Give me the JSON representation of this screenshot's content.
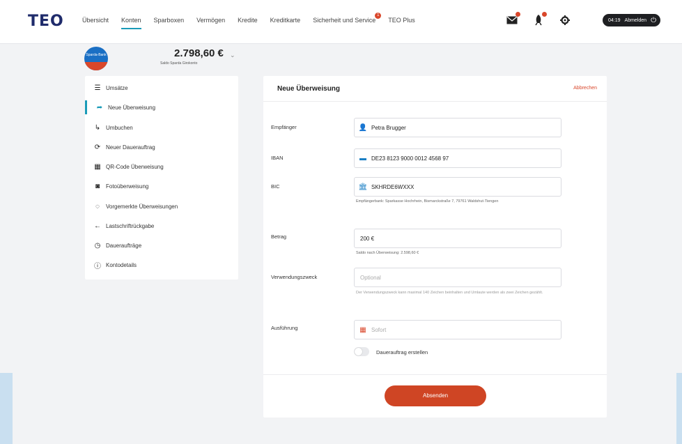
{
  "header": {
    "logo": "TEO",
    "nav": [
      "Übersicht",
      "Konten",
      "Sparboxen",
      "Vermögen",
      "Kredite",
      "Kreditkarte",
      "Sicherheit und Service",
      "TEO Plus"
    ],
    "active_nav": "Konten",
    "service_badge": "1",
    "icons": [
      "mail-icon",
      "rocket-icon",
      "gear-icon"
    ],
    "session_time": "04:19",
    "logout_label": "Abmelden"
  },
  "account": {
    "bank_logo_text": "Sparda-Bank",
    "balance": "2.798,60 €",
    "subtitle": "Saldo Sparda Girokonto"
  },
  "sidebar": {
    "items": [
      {
        "label": "Umsätze",
        "icon": "list-icon"
      },
      {
        "label": "Neue Überweisung",
        "icon": "transfer-icon",
        "active": true
      },
      {
        "label": "Umbuchen",
        "icon": "rebook-icon"
      },
      {
        "label": "Neuer Dauerauftrag",
        "icon": "repeat-icon"
      },
      {
        "label": "QR-Code Überweisung",
        "icon": "qr-icon"
      },
      {
        "label": "Fotoüberweisung",
        "icon": "camera-icon"
      },
      {
        "label": "Vorgemerkte Überweisungen",
        "icon": "pending-icon"
      },
      {
        "label": "Lastschriftrückgabe",
        "icon": "back-arrow-icon"
      },
      {
        "label": "Daueraufträge",
        "icon": "clock-icon"
      },
      {
        "label": "Kontodetails",
        "icon": "info-icon"
      }
    ]
  },
  "form": {
    "title": "Neue Überweisung",
    "cancel_label": "Abbrechen",
    "recipient_label": "Empfänger",
    "recipient_value": "Petra Brugger",
    "iban_label": "IBAN",
    "iban_value": "DE23 8123 9000 0012 4568 97",
    "bic_label": "BIC",
    "bic_value": "SKHRDE6WXXX",
    "bic_hint": "Empfängerbank: Sparkasse Hochrhein, Bismarckstraße 7, 79761 Waldshut-Tiengen",
    "amount_label": "Betrag",
    "amount_value": "200 €",
    "amount_hint": "Saldo nach Überweisung: 2.598,60 €",
    "purpose_label": "Verwendungszweck",
    "purpose_placeholder": "Optional",
    "purpose_hint": "Der Verwendungszweck kann maximal 140 Zeichen beinhalten und Umlaute werden als zwei Zeichen gezählt.",
    "execution_label": "Ausführung",
    "execution_value": "Sofort",
    "standing_order_label": "Dauerauftrag erstellen",
    "submit_label": "Absenden"
  },
  "colors": {
    "accent": "#1a9bb8",
    "brand_red": "#cf4524",
    "navy": "#1f2b6b"
  }
}
